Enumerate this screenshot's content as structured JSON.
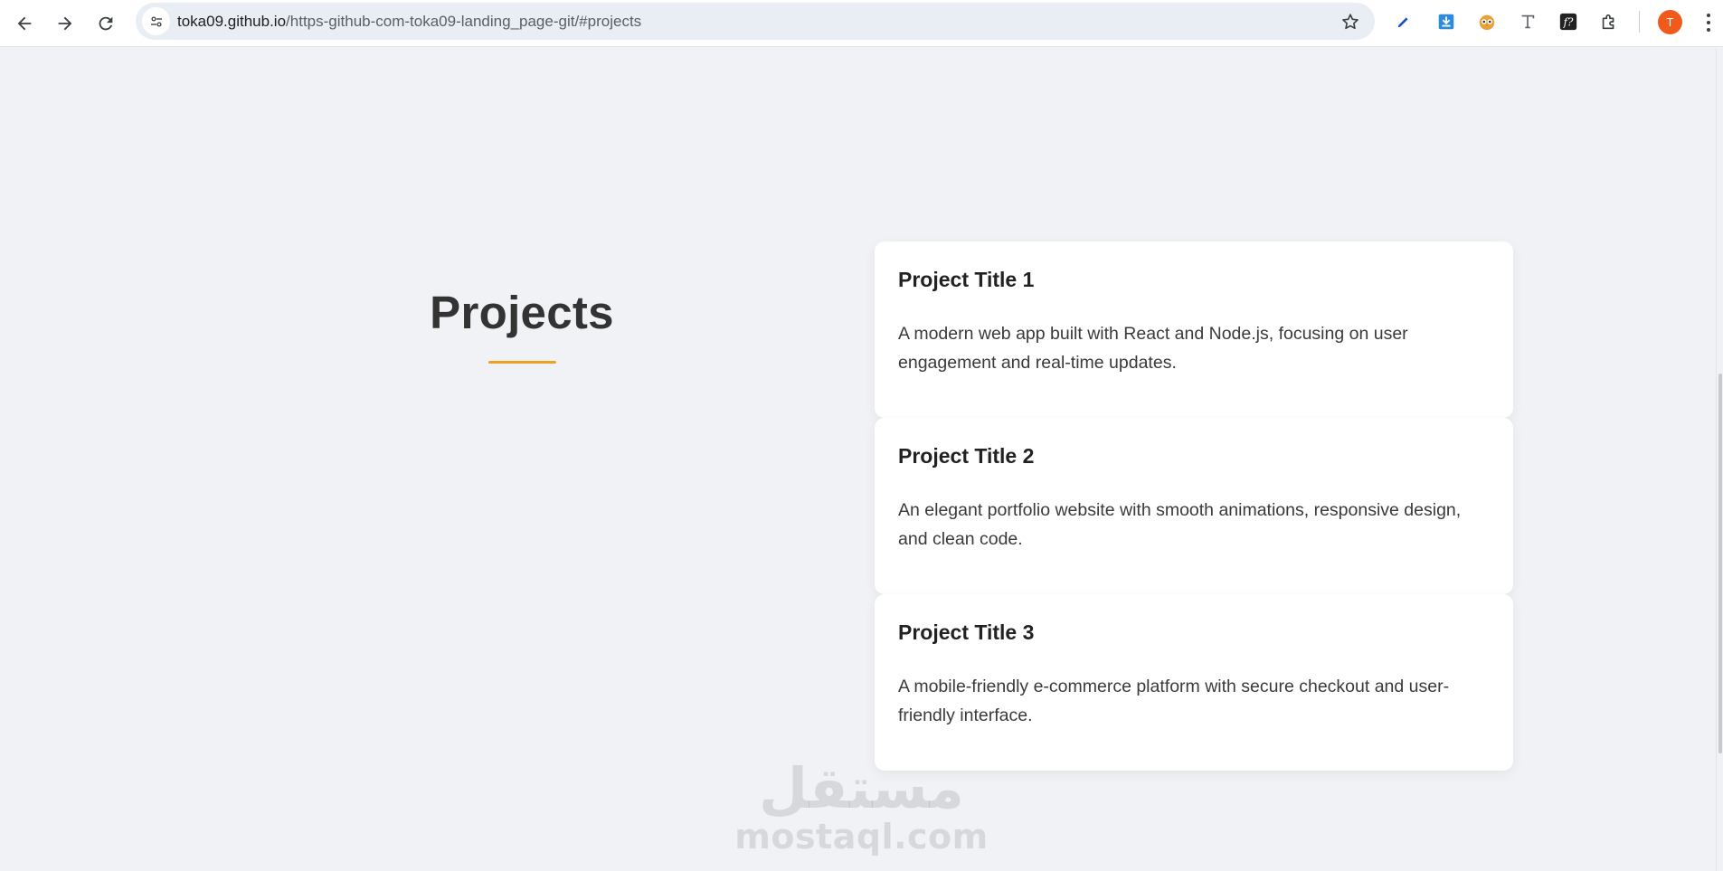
{
  "browser": {
    "url_host": "toka09.github.io",
    "url_path": "/https-github-com-toka09-landing_page-git/#projects",
    "profile_initial": "T",
    "icons": {
      "back": "arrow-left-icon",
      "forward": "arrow-right-icon",
      "reload": "reload-icon",
      "site_info": "tune-icon",
      "bookmark": "star-icon",
      "extensions": [
        "pen-icon",
        "download-icon",
        "owl-icon",
        "text-t-icon",
        "fx-icon",
        "puzzle-icon"
      ],
      "menu": "kebab-menu-icon"
    },
    "colors": {
      "profile": "#f05a1a",
      "download_ext": "#1a73e8"
    }
  },
  "section": {
    "title": "Projects",
    "accent_color": "#f0a020"
  },
  "projects": [
    {
      "title": "Project Title 1",
      "description": "A modern web app built with React and Node.js, focusing on user engagement and real-time updates."
    },
    {
      "title": "Project Title 2",
      "description": "An elegant portfolio website with smooth animations, responsive design, and clean code."
    },
    {
      "title": "Project Title 3",
      "description": "A mobile-friendly e-commerce platform with secure checkout and user-friendly interface."
    }
  ],
  "watermark": {
    "arabic": "مستقل",
    "latin": "mostaql.com"
  }
}
